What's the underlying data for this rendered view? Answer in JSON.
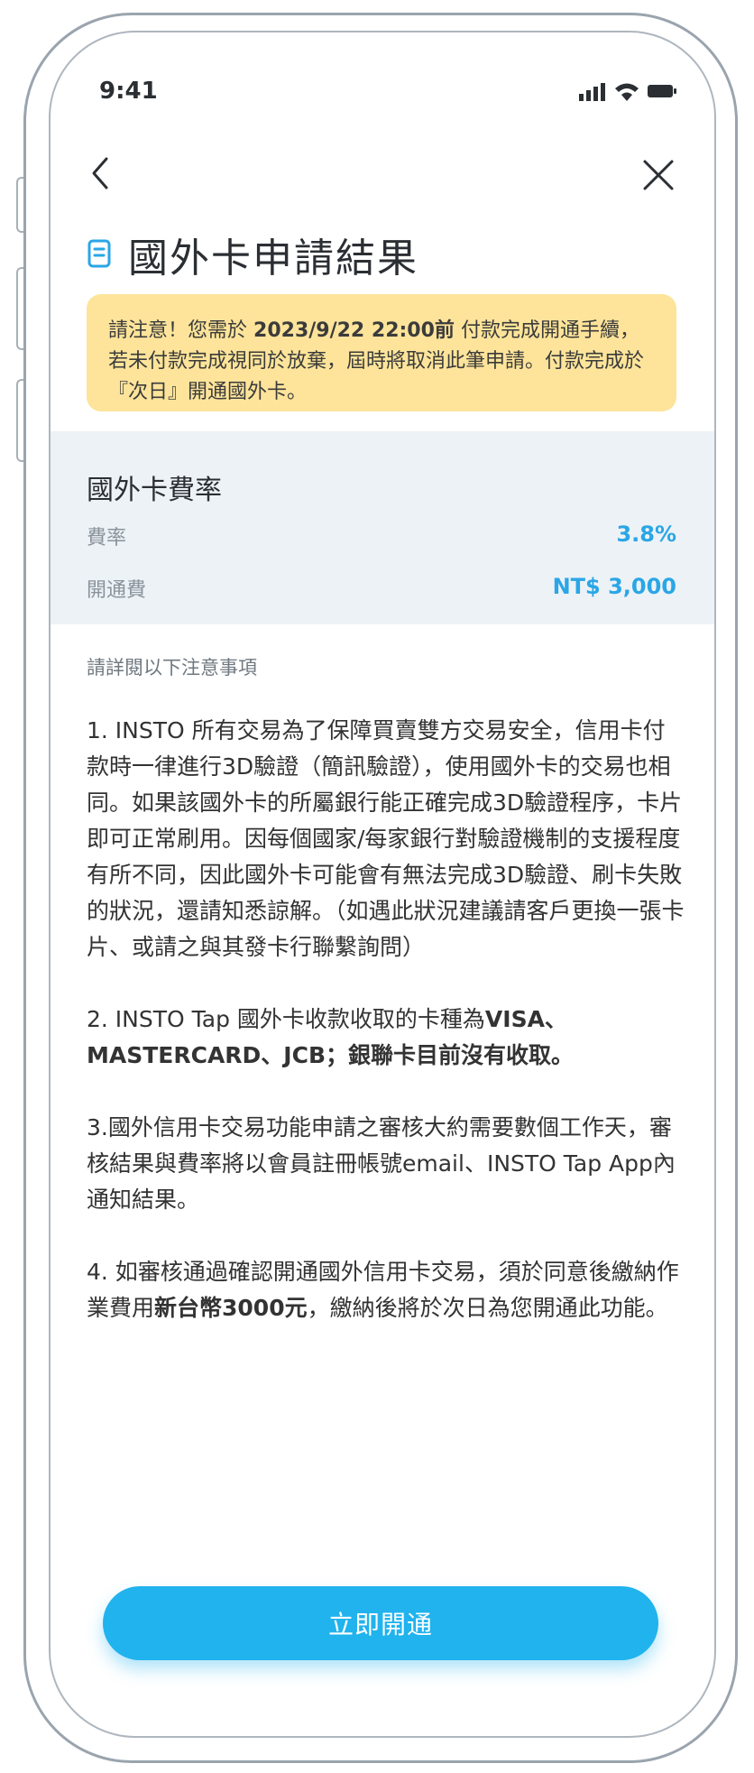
{
  "status": {
    "time": "9:41"
  },
  "header": {
    "title": "國外卡申請結果"
  },
  "notice": {
    "prefix": "請注意！您需於",
    "deadline": "2023/9/22 22:00前",
    "suffix": "付款完成開通手續，若未付款完成視同於放棄，屆時將取消此筆申請。付款完成於『次日』開通國外卡。"
  },
  "fees": {
    "title": "國外卡費率",
    "rate_label": "費率",
    "rate_value": "3.8%",
    "open_fee_label": "開通費",
    "open_fee_value": "NT$ 3,000"
  },
  "notes": {
    "title": "請詳閱以下注意事項",
    "p1": "1. INSTO 所有交易為了保障買賣雙方交易安全，信用卡付款時一律進行3D驗證（簡訊驗證），使用國外卡的交易也相同。如果該國外卡的所屬銀行能正確完成3D驗證程序，卡片即可正常刷用。因每個國家/每家銀行對驗證機制的支援程度有所不同，因此國外卡可能會有無法完成3D驗證、刷卡失敗的狀況，還請知悉諒解。（如遇此狀況建議請客戶更換一張卡片、或請之與其發卡行聯繫詢問）",
    "p2_prefix": "2. INSTO Tap 國外卡收款收取的卡種為",
    "p2_bold": "VISA、MASTERCARD、JCB；銀聯卡目前沒有收取。",
    "p3": "3.國外信用卡交易功能申請之審核大約需要數個工作天，審核結果與費率將以會員註冊帳號email、INSTO Tap App內通知結果。",
    "p4_prefix": "4. 如審核通過確認開通國外信用卡交易，須於同意後繳納作業費用",
    "p4_bold": "新台幣3000元",
    "p4_suffix": "，繳納後將於次日為您開通此功能。"
  },
  "cta": {
    "label": "立即開通"
  },
  "colors": {
    "accent": "#20b3ee",
    "notice_bg": "#fde49a",
    "panel_bg": "#edf2f6",
    "value": "#2aa6e6"
  },
  "icons": [
    "back-icon",
    "close-icon",
    "receipt-icon",
    "signal-icon",
    "wifi-icon",
    "battery-icon"
  ]
}
